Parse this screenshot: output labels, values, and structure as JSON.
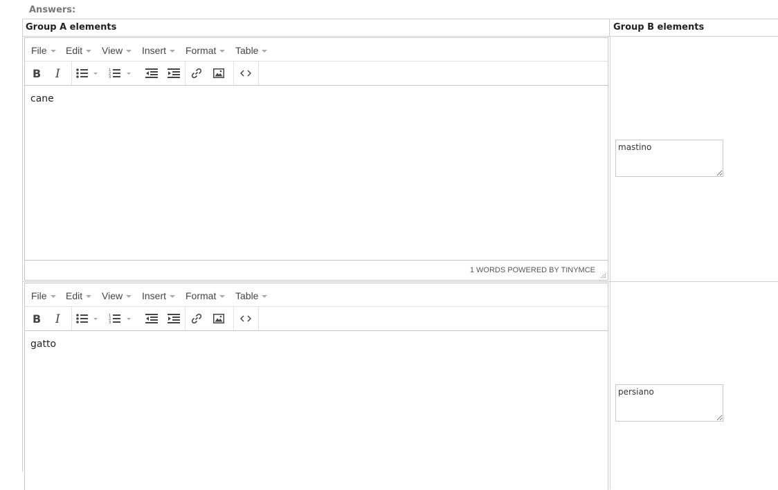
{
  "answers_label": "Answers:",
  "headers": {
    "group_a": "Group A elements",
    "group_b": "Group B elements"
  },
  "menu": [
    "File",
    "Edit",
    "View",
    "Insert",
    "Format",
    "Table"
  ],
  "toolbar_icons": [
    "bold-icon",
    "italic-icon",
    "bullet-list-icon",
    "numbered-list-icon",
    "outdent-icon",
    "indent-icon",
    "link-icon",
    "image-icon",
    "source-code-icon"
  ],
  "rows": [
    {
      "editor_content": "cane",
      "status": "1 WORDS POWERED BY TINYMCE",
      "answer": "mastino"
    },
    {
      "editor_content": "gatto",
      "answer": "persiano"
    }
  ],
  "colors": {
    "border": "#cfcfcf",
    "label": "#777777",
    "icon": "#444444"
  }
}
